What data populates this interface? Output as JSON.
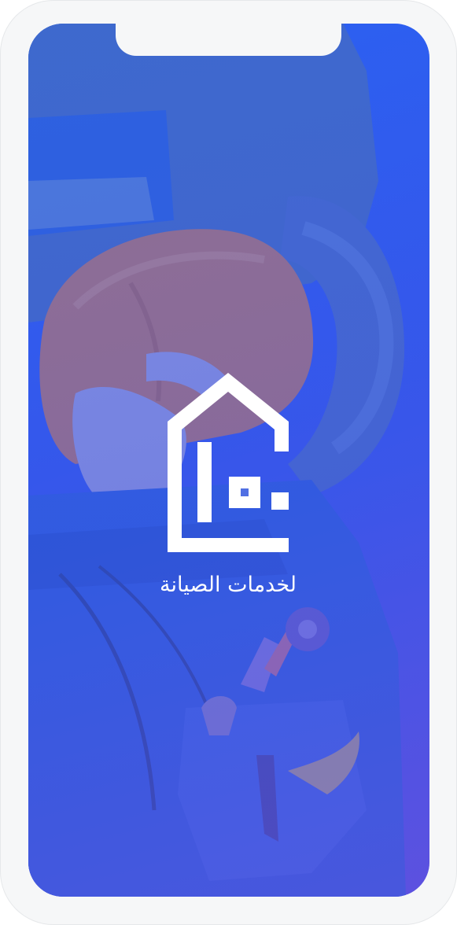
{
  "splash": {
    "tagline": "لخدمات الصيانة",
    "logo_icon": "house-logo-icon",
    "background_image": "worker-with-helmet-and-tool-belt"
  },
  "colors": {
    "gradient_top": "#2b63f0",
    "gradient_bottom": "#5a52de",
    "logo": "#ffffff",
    "frame": "#f6f7f8"
  }
}
